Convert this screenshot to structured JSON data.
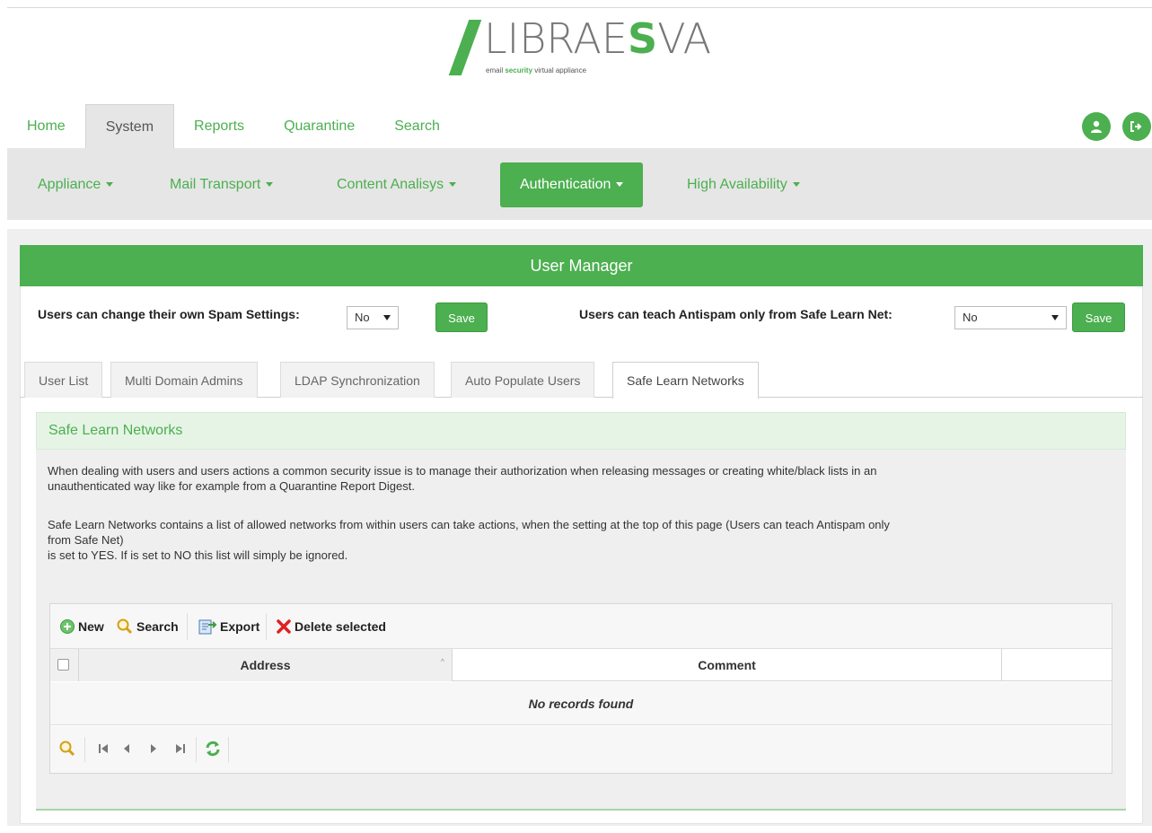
{
  "brand": {
    "wordmark_start": "LIBRAE",
    "wordmark_bold": "S",
    "wordmark_end": "VA",
    "tagline_start": "email ",
    "tagline_green": "security",
    "tagline_end": " virtual appliance"
  },
  "top_tabs": [
    {
      "label": "Home",
      "active": false
    },
    {
      "label": "System",
      "active": true
    },
    {
      "label": "Reports",
      "active": false
    },
    {
      "label": "Quarantine",
      "active": false
    },
    {
      "label": "Search",
      "active": false
    }
  ],
  "subnav": [
    {
      "label": "Appliance",
      "active": false
    },
    {
      "label": "Mail Transport",
      "active": false
    },
    {
      "label": "Content Analisys",
      "active": false
    },
    {
      "label": "Authentication",
      "active": true
    },
    {
      "label": "High Availability",
      "active": false
    }
  ],
  "panel": {
    "title": "User Manager",
    "setting1_label": "Users can change their own Spam Settings:",
    "setting1_value": "No",
    "setting2_label": "Users can teach Antispam only from Safe Learn Net:",
    "setting2_value": "No",
    "save_label": "Save"
  },
  "tabs": [
    {
      "label": "User List",
      "active": false
    },
    {
      "label": "Multi Domain Admins",
      "active": false
    },
    {
      "label": "LDAP Synchronization",
      "active": false
    },
    {
      "label": "Auto Populate Users",
      "active": false
    },
    {
      "label": "Safe Learn Networks",
      "active": true
    }
  ],
  "section": {
    "title": "Safe Learn Networks",
    "para1_line1": "When dealing with users and users actions a common security issue is to manage their authorization when releasing messages or creating white/black lists in an",
    "para1_line2": "unauthenticated way like for example from a Quarantine Report Digest.",
    "para2_line1": "Safe Learn Networks contains a list of allowed networks from within users can take actions, when the setting at the top of this page (Users can teach Antispam only",
    "para2_line2": "from Safe Net)",
    "para2_line3": "is set to YES. If is set to NO this list will simply be ignored."
  },
  "grid": {
    "toolbar": {
      "new_label": "New",
      "search_label": "Search",
      "export_label": "Export",
      "delete_label": "Delete selected"
    },
    "columns": [
      "Address",
      "Comment"
    ],
    "empty_message": "No records found"
  },
  "colors": {
    "accent": "#4caf50",
    "subnav_bg": "#e6e6e6",
    "section_header_bg": "#e6f4e6"
  },
  "icons": {
    "user": "user-icon",
    "logout": "logout-icon",
    "new": "plus-circle-icon",
    "search": "magnifier-icon",
    "export": "export-icon",
    "delete": "red-x-icon",
    "pager_search": "magnifier-icon",
    "first": "first-page-icon",
    "prev": "prev-page-icon",
    "next": "next-page-icon",
    "last": "last-page-icon",
    "refresh": "refresh-icon"
  }
}
